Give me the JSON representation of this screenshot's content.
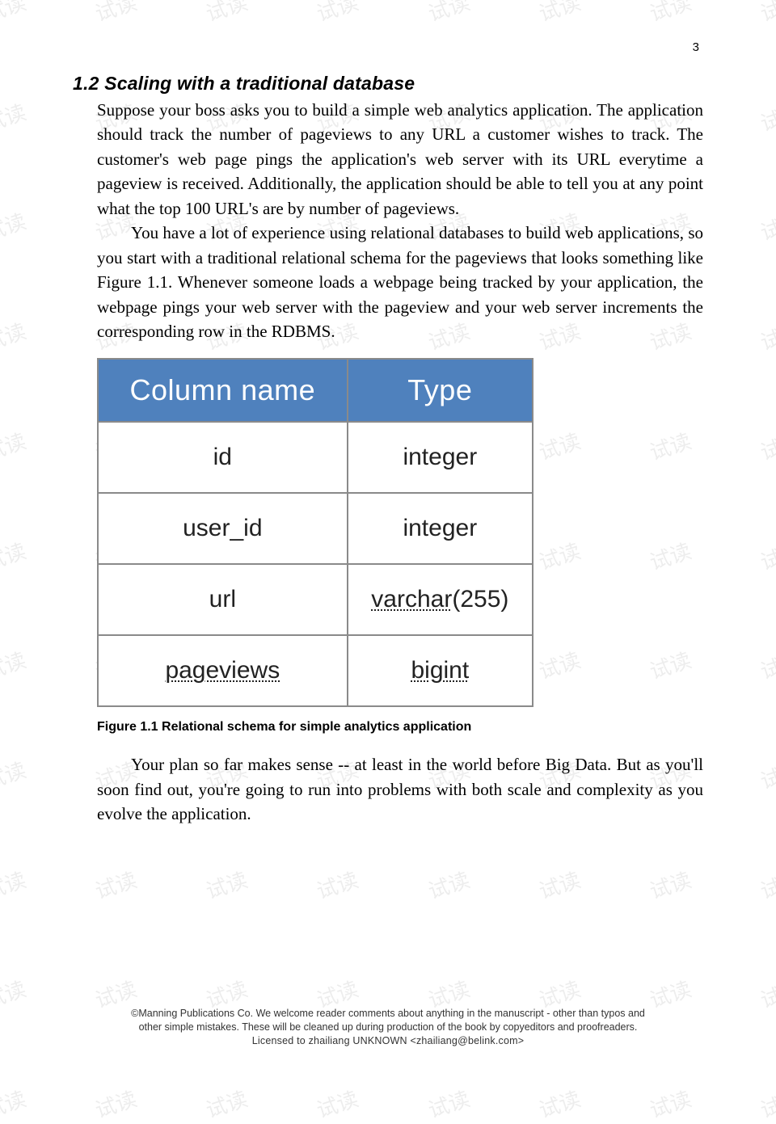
{
  "watermark_text": "试读",
  "page_number": "3",
  "section": {
    "heading": "1.2 Scaling with a traditional database",
    "para1": "Suppose your boss asks you to build a simple web analytics application. The application should track the number of pageviews to any URL a customer wishes to track. The customer's web page pings the application's web server with its URL everytime a pageview is received. Additionally, the application should be able to tell you at any point what the top 100 URL's are by number of pageviews.",
    "para2": "You have a lot of experience using relational databases to build web applications, so you start with a traditional relational schema for the pageviews that looks something like Figure 1.1. Whenever someone loads a webpage being tracked by your application, the webpage pings your web server with the pageview and your web server increments the corresponding row in the RDBMS.",
    "para3": "Your plan so far makes sense -- at least in the world before Big Data. But as you'll soon find out, you're going to run into problems with both scale and complexity as you evolve the application."
  },
  "figure": {
    "headers": {
      "col1": "Column name",
      "col2": "Type"
    },
    "rows": [
      {
        "name": "id",
        "type": "integer",
        "name_dashed": false,
        "type_dashed": false
      },
      {
        "name": "user_id",
        "type": "integer",
        "name_dashed": false,
        "type_dashed": false
      },
      {
        "name": "url",
        "type_prefix": "varchar",
        "type_suffix": "(255)",
        "name_dashed": false,
        "type_dashed": true
      },
      {
        "name": "pageviews",
        "type": "bigint",
        "name_dashed": true,
        "type_dashed": true
      }
    ],
    "caption": "Figure 1.1 Relational schema for simple analytics application"
  },
  "footer": {
    "line1": "©Manning Publications Co. We welcome reader comments about anything in the manuscript - other than typos and",
    "line2": "other simple mistakes. These will be cleaned up during production of the book by copyeditors and proofreaders.",
    "line3": "Licensed to zhailiang UNKNOWN <zhailiang@belink.com>"
  }
}
